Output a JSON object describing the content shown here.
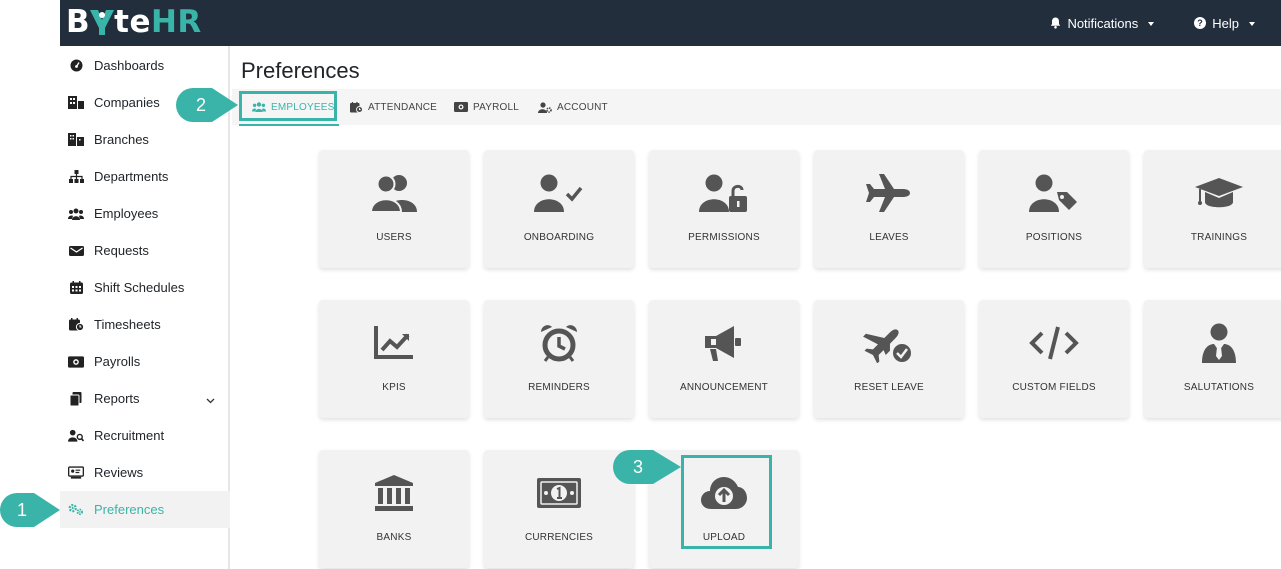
{
  "app": {
    "logo_left": "B",
    "logo_mid": "te",
    "logo_right": "HR"
  },
  "topnav": {
    "notifications": "Notifications",
    "help": "Help"
  },
  "sidebar": {
    "items": [
      {
        "label": "Dashboards",
        "icon": "dashboard-icon"
      },
      {
        "label": "Companies",
        "icon": "companies-icon"
      },
      {
        "label": "Branches",
        "icon": "branches-icon"
      },
      {
        "label": "Departments",
        "icon": "departments-icon"
      },
      {
        "label": "Employees",
        "icon": "employees-icon"
      },
      {
        "label": "Requests",
        "icon": "requests-icon"
      },
      {
        "label": "Shift Schedules",
        "icon": "calendar-icon"
      },
      {
        "label": "Timesheets",
        "icon": "timesheet-icon"
      },
      {
        "label": "Payrolls",
        "icon": "payroll-icon"
      },
      {
        "label": "Reports",
        "icon": "reports-icon"
      },
      {
        "label": "Recruitment",
        "icon": "recruitment-icon"
      },
      {
        "label": "Reviews",
        "icon": "reviews-icon"
      },
      {
        "label": "Preferences",
        "icon": "cogs-icon"
      }
    ]
  },
  "main": {
    "title": "Preferences",
    "tabs": [
      {
        "label": "EMPLOYEES"
      },
      {
        "label": "ATTENDANCE"
      },
      {
        "label": "PAYROLL"
      },
      {
        "label": "ACCOUNT"
      }
    ],
    "cards": [
      {
        "label": "USERS",
        "icon": "users-icon"
      },
      {
        "label": "ONBOARDING",
        "icon": "user-check-icon"
      },
      {
        "label": "PERMISSIONS",
        "icon": "user-lock-icon"
      },
      {
        "label": "LEAVES",
        "icon": "plane-icon"
      },
      {
        "label": "POSITIONS",
        "icon": "user-tag-icon"
      },
      {
        "label": "TRAININGS",
        "icon": "graduation-cap-icon"
      },
      {
        "label": "KPIS",
        "icon": "chart-line-icon"
      },
      {
        "label": "REMINDERS",
        "icon": "alarm-clock-icon"
      },
      {
        "label": "ANNOUNCEMENT",
        "icon": "megaphone-icon"
      },
      {
        "label": "RESET LEAVE",
        "icon": "plane-check-icon"
      },
      {
        "label": "CUSTOM FIELDS",
        "icon": "code-icon"
      },
      {
        "label": "SALUTATIONS",
        "icon": "user-tie-icon"
      },
      {
        "label": "BANKS",
        "icon": "bank-icon"
      },
      {
        "label": "CURRENCIES",
        "icon": "money-bill-icon"
      },
      {
        "label": "UPLOAD",
        "icon": "cloud-upload-icon"
      }
    ]
  },
  "callouts": {
    "one": "1",
    "two": "2",
    "three": "3"
  },
  "colors": {
    "accent": "#3ab4a8",
    "topbar": "#222e3c",
    "card": "#f2f2f2",
    "icon": "#555555"
  }
}
